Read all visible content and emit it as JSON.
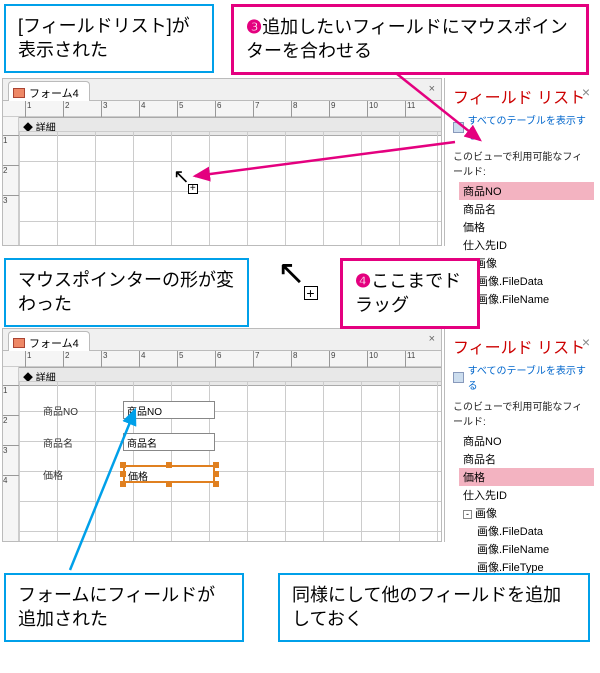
{
  "callouts": {
    "c1": "[フィールドリスト]が表示された",
    "c3_num": "❸",
    "c3": "追加したいフィールドにマウスポインターを合わせる",
    "c_pointer": "マウスポインターの形が変わった",
    "c4_num": "❹",
    "c4": "ここまでドラッグ",
    "c_added": "フォームにフィールドが追加された",
    "c_repeat": "同様にして他のフィールドを追加しておく"
  },
  "pane1": {
    "tab": "フォーム4",
    "section": "◆ 詳細"
  },
  "pane2": {
    "tab": "フォーム4",
    "section": "◆ 詳細",
    "fields": {
      "f1_label": "商品NO",
      "f1_ctrl": "商品NO",
      "f2_label": "商品名",
      "f2_ctrl": "商品名",
      "f3_label": "価格",
      "f3_ctrl": "価格"
    }
  },
  "fieldlist": {
    "title": "フィールド リスト",
    "showAll": "すべてのテーブルを表示する",
    "availLabel1": "このビューで利用可能なフィールド:",
    "availLabel2": "このビューで利用可能なフィールド:",
    "items1": [
      "商品NO",
      "商品名",
      "価格",
      "仕入先ID"
    ],
    "imgGroup": "画像",
    "imgChildren1": [
      "画像.FileData",
      "画像.FileName"
    ],
    "items2": [
      "商品NO",
      "商品名",
      "価格",
      "仕入先ID"
    ],
    "imgChildren2": [
      "画像.FileData",
      "画像.FileName",
      "画像.FileType"
    ]
  },
  "colors": {
    "blue": "#00a0e9",
    "pink": "#e4007f",
    "red": "#c00"
  }
}
